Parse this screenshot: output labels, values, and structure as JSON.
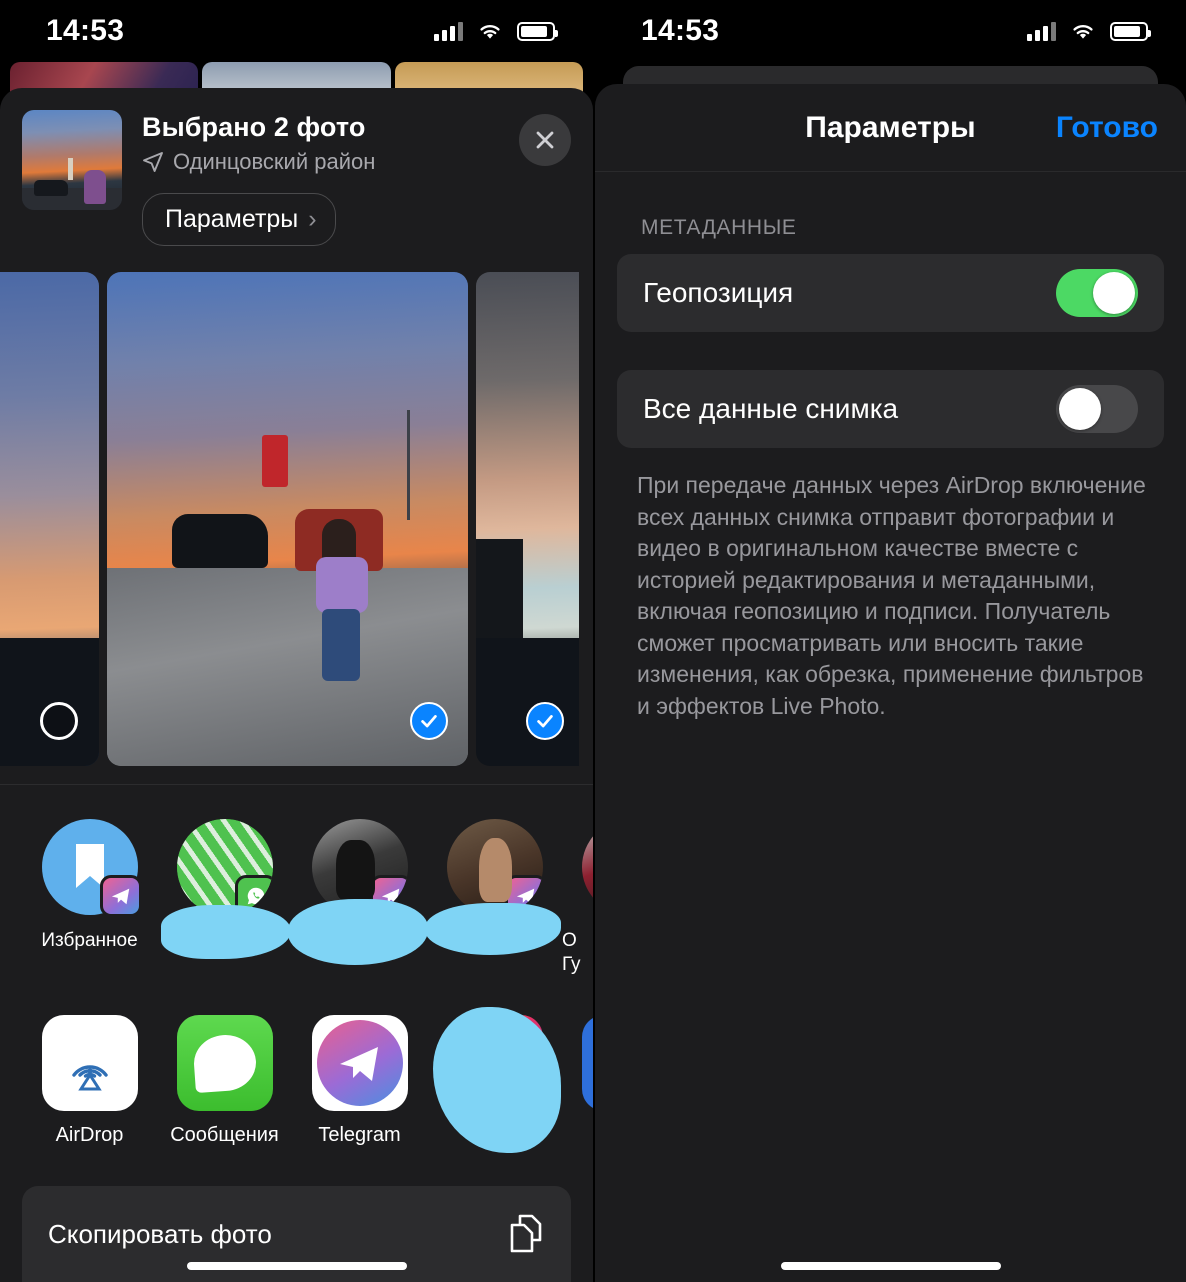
{
  "statusbar": {
    "time": "14:53"
  },
  "left": {
    "share_sheet": {
      "selection_title": "Выбрано 2 фото",
      "location": "Одинцовский район",
      "location_icon": "location-arrow-icon",
      "options_button": "Параметры",
      "options_chevron": "chevron-right-icon",
      "close_icon": "close-icon"
    },
    "photos": [
      {
        "name": "photo-thumb-left",
        "selected": false
      },
      {
        "name": "photo-thumb-center",
        "selected": true
      },
      {
        "name": "photo-thumb-right",
        "selected": true
      }
    ],
    "contacts": [
      {
        "label": "Избранное",
        "badge": "telegram-badge-icon",
        "redacted": false
      },
      {
        "label": "",
        "badge": "whatsapp-badge-icon",
        "redacted": true
      },
      {
        "label": "",
        "badge": "telegram-badge-icon",
        "redacted": true
      },
      {
        "label": "",
        "badge": "telegram-badge-icon",
        "redacted": true
      },
      {
        "label": "О\nГу",
        "badge": "",
        "redacted": false
      }
    ],
    "apps": [
      {
        "label": "AirDrop",
        "icon": "airdrop-icon"
      },
      {
        "label": "Сообщения",
        "icon": "messages-icon"
      },
      {
        "label": "Telegram",
        "icon": "telegram-icon"
      },
      {
        "label": "",
        "icon": "instagram-icon"
      },
      {
        "label": "",
        "icon": "blue-app-icon"
      }
    ],
    "actions": [
      {
        "label": "Скопировать фото",
        "icon": "copy-icon"
      }
    ]
  },
  "right": {
    "nav": {
      "title": "Параметры",
      "done": "Готово"
    },
    "section_header": "МЕТАДАННЫЕ",
    "rows": [
      {
        "label": "Геопозиция",
        "state": "on"
      },
      {
        "label": "Все данные снимка",
        "state": "off"
      }
    ],
    "footnote": "При передаче данных через AirDrop включение всех данных снимка отправит фотографии и видео в оригинальном качестве вместе с историей редактирования и метаданными, включая геопозицию и подписи. Получатель сможет просматривать или вносить такие изменения, как обрезка, применение фильтров и эффектов Live Photo."
  },
  "colors": {
    "accent_blue": "#0A84FF",
    "toggle_on": "#4CD964",
    "toggle_off": "#48484A",
    "sheet_bg": "#1C1C1E",
    "card_bg": "#2C2C2E"
  }
}
